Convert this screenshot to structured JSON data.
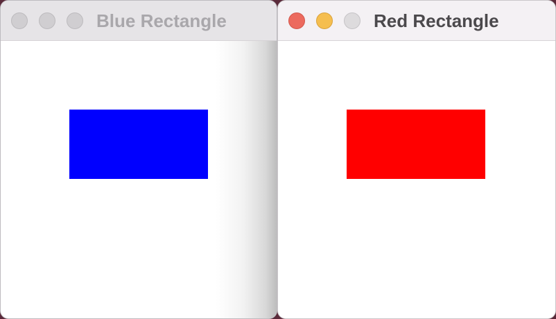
{
  "windows": {
    "blue": {
      "title": "Blue Rectangle",
      "state": "inactive",
      "rect_color": "#0000ff"
    },
    "red": {
      "title": "Red Rectangle",
      "state": "active",
      "rect_color": "#ff0000"
    }
  },
  "colors": {
    "close_active": "#ec6a5e",
    "minimize_active": "#f5be4f",
    "inactive_light": "#d0ced1"
  }
}
